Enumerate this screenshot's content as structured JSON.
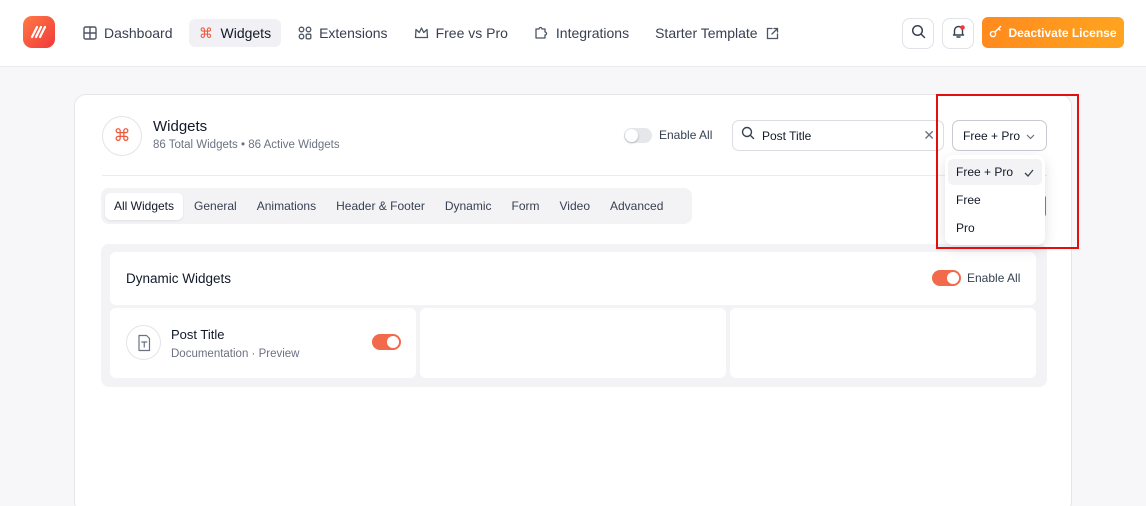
{
  "nav": {
    "items": [
      {
        "label": "Dashboard",
        "icon": "grid-icon",
        "active": false
      },
      {
        "label": "Widgets",
        "icon": "command-icon",
        "active": true
      },
      {
        "label": "Extensions",
        "icon": "extensions-icon",
        "active": false
      },
      {
        "label": "Free vs Pro",
        "icon": "crown-icon",
        "active": false
      },
      {
        "label": "Integrations",
        "icon": "puzzle-icon",
        "active": false
      },
      {
        "label": "Starter Template",
        "icon": "external-link-icon",
        "active": false
      }
    ],
    "deactivate_label": "Deactivate License"
  },
  "header": {
    "title": "Widgets",
    "subtitle": "86 Total Widgets • 86 Active Widgets",
    "enable_all_label": "Enable All",
    "search_value": "Post Title",
    "filter_value": "Free + Pro"
  },
  "tabs": [
    "All Widgets",
    "General",
    "Animations",
    "Header & Footer",
    "Dynamic",
    "Form",
    "Video",
    "Advanced"
  ],
  "section": {
    "title": "Dynamic Widgets",
    "enable_all_label": "Enable All",
    "cards": [
      {
        "title": "Post Title",
        "links": "Documentation · Preview",
        "enabled": true
      }
    ]
  },
  "dropdown": {
    "options": [
      "Free + Pro",
      "Free",
      "Pro"
    ],
    "selected": "Free + Pro"
  },
  "colors": {
    "accent": "#f0573a",
    "toggle_on": "#f26a4b",
    "deactivate_start": "#ff8a1e",
    "deactivate_end": "#ffa41f",
    "highlight": "#e01010"
  }
}
